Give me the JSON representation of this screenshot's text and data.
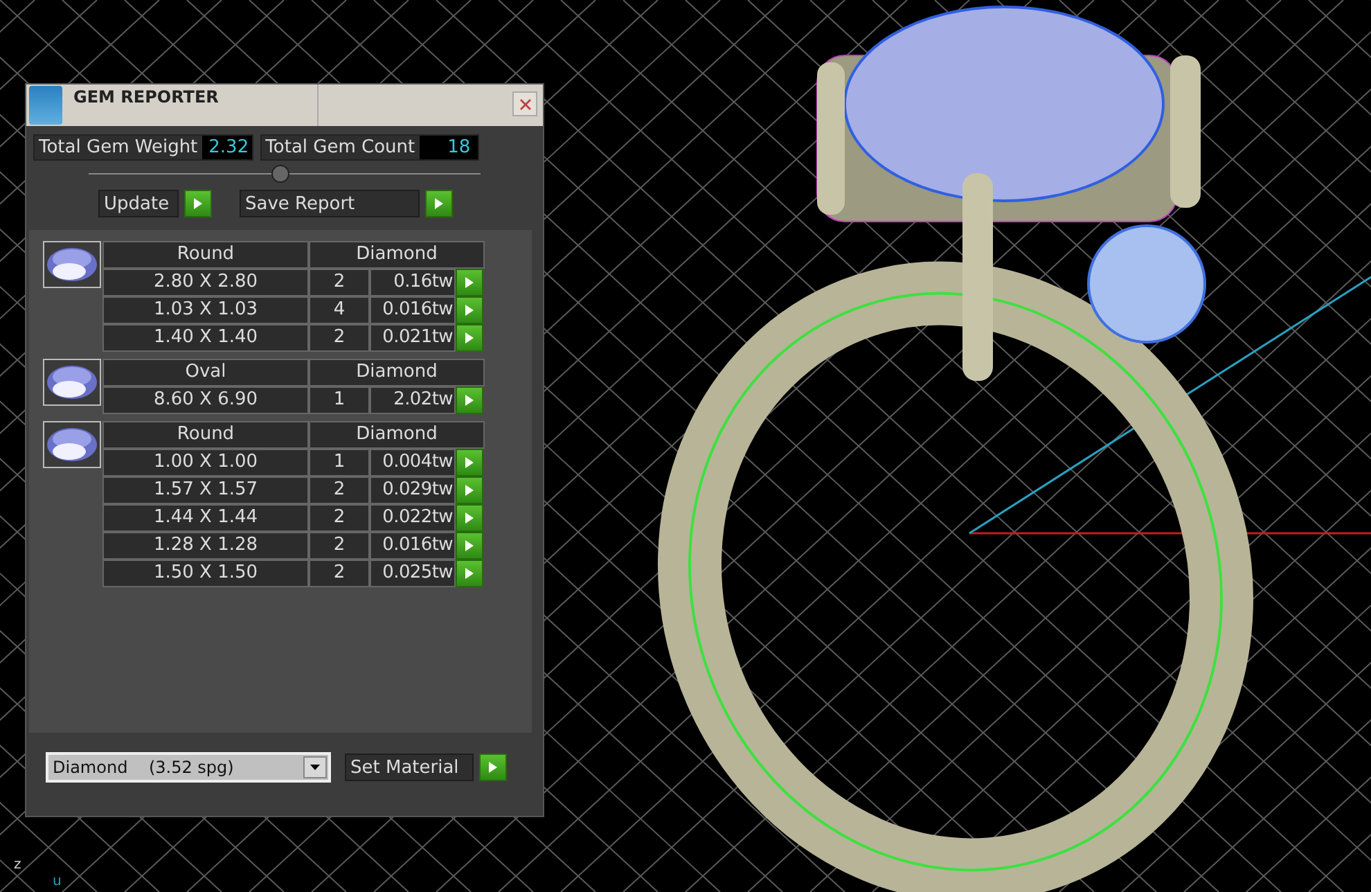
{
  "panel": {
    "title": "GEM REPORTER",
    "totals": [
      {
        "label": "Total Gem Weight",
        "value": "2.32"
      },
      {
        "label": "Total Gem Count",
        "value": "18"
      }
    ],
    "buttons": [
      "Update",
      "Save Report"
    ],
    "groups": [
      {
        "shape": "Round",
        "material": "Diamond",
        "rows": [
          {
            "size": "2.80 X 2.80",
            "count": "2",
            "weight": "0.16tw"
          },
          {
            "size": "1.03 X 1.03",
            "count": "4",
            "weight": "0.016tw"
          },
          {
            "size": "1.40 X 1.40",
            "count": "2",
            "weight": "0.021tw"
          }
        ]
      },
      {
        "shape": "Oval",
        "material": "Diamond",
        "rows": [
          {
            "size": "8.60 X 6.90",
            "count": "1",
            "weight": "2.02tw"
          }
        ]
      },
      {
        "shape": "Round",
        "material": "Diamond",
        "rows": [
          {
            "size": "1.00 X 1.00",
            "count": "1",
            "weight": "0.004tw"
          },
          {
            "size": "1.57 X 1.57",
            "count": "2",
            "weight": "0.029tw"
          },
          {
            "size": "1.44 X 1.44",
            "count": "2",
            "weight": "0.022tw"
          },
          {
            "size": "1.28 X 1.28",
            "count": "2",
            "weight": "0.016tw"
          },
          {
            "size": "1.50 X 1.50",
            "count": "2",
            "weight": "0.025tw"
          }
        ]
      }
    ],
    "material_dropdown": {
      "value": "Diamond    (3.52 spg)"
    },
    "set_button": "Set Material"
  },
  "axes": [
    {
      "label": "z"
    },
    {
      "label": "u"
    }
  ]
}
